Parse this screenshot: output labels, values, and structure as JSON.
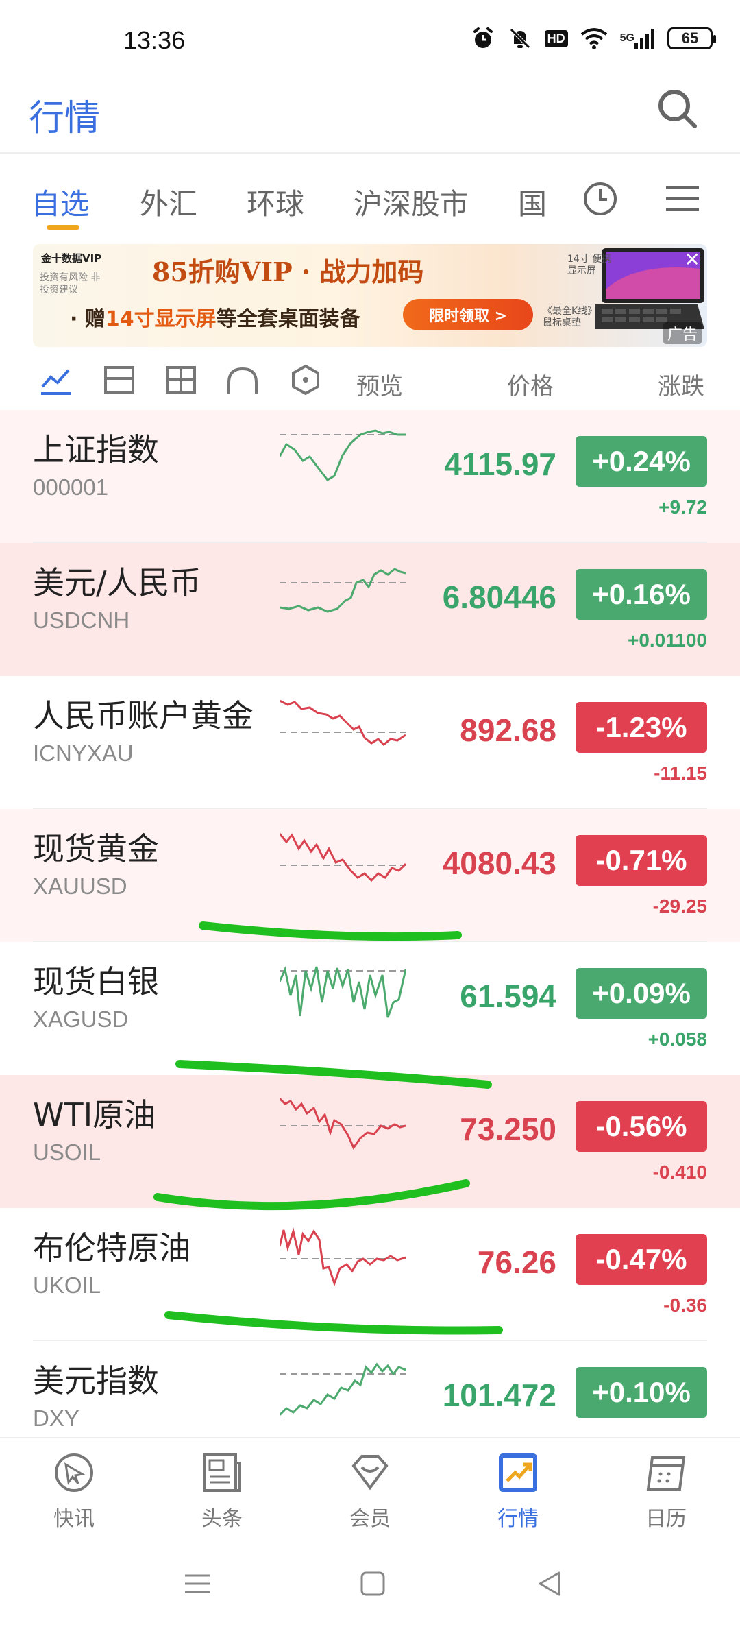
{
  "status_bar": {
    "time": "13:36",
    "battery": "65",
    "hd": "HD",
    "network": "5G"
  },
  "header": {
    "title": "行情"
  },
  "tabs": [
    {
      "label": "自选",
      "active": true
    },
    {
      "label": "外汇"
    },
    {
      "label": "环球"
    },
    {
      "label": "沪深股市"
    },
    {
      "label": "国"
    }
  ],
  "banner": {
    "logo": "金十数据VIP",
    "sub": "投资有风险 非投资建议",
    "headline": "85折购VIP · 战力加码",
    "line2_prefix": "· 赠",
    "line2_highlight": "14寸显示屏",
    "line2_suffix": "等全套桌面装备",
    "cta": "限时领取 >",
    "tag_monitor": "14寸 便携显示屏",
    "tag_mousepad": "《最全K线》 鼠标桌垫",
    "ad_label": "广告"
  },
  "toolbar": {
    "preview": "预览",
    "price": "价格",
    "change": "涨跌"
  },
  "quotes": [
    {
      "name": "上证指数",
      "code": "000001",
      "price": "4115.97",
      "pct": "+0.24%",
      "chg": "+9.72",
      "dir": "up"
    },
    {
      "name": "美元/人民币",
      "code": "USDCNH",
      "price": "6.80446",
      "pct": "+0.16%",
      "chg": "+0.01100",
      "dir": "up"
    },
    {
      "name": "人民币账户黄金",
      "code": "ICNYXAU",
      "price": "892.68",
      "pct": "-1.23%",
      "chg": "-11.15",
      "dir": "down"
    },
    {
      "name": "现货黄金",
      "code": "XAUUSD",
      "price": "4080.43",
      "pct": "-0.71%",
      "chg": "-29.25",
      "dir": "down"
    },
    {
      "name": "现货白银",
      "code": "XAGUSD",
      "price": "61.594",
      "pct": "+0.09%",
      "chg": "+0.058",
      "dir": "up"
    },
    {
      "name": "WTI原油",
      "code": "USOIL",
      "price": "73.250",
      "pct": "-0.56%",
      "chg": "-0.410",
      "dir": "down"
    },
    {
      "name": "布伦特原油",
      "code": "UKOIL",
      "price": "76.26",
      "pct": "-0.47%",
      "chg": "-0.36",
      "dir": "down"
    },
    {
      "name": "美元指数",
      "code": "DXY",
      "price": "101.472",
      "pct": "+0.10%",
      "chg": "",
      "dir": "up"
    }
  ],
  "bottom_nav": [
    {
      "label": "快讯",
      "icon": "flash-news-icon"
    },
    {
      "label": "头条",
      "icon": "headlines-icon"
    },
    {
      "label": "会员",
      "icon": "vip-diamond-icon"
    },
    {
      "label": "行情",
      "icon": "market-chart-icon",
      "active": true
    },
    {
      "label": "日历",
      "icon": "calendar-icon"
    }
  ],
  "colors": {
    "accent": "#3a6fe0",
    "up": "#49a96f",
    "down": "#e0404f",
    "tab_underline": "#f0a51e"
  }
}
